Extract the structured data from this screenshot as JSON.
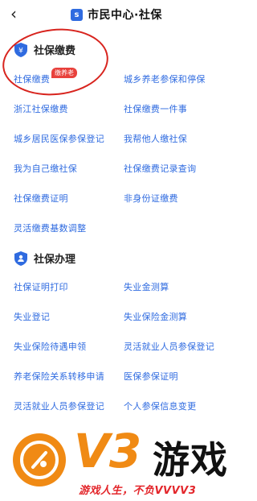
{
  "header": {
    "title": "市民中心·社保",
    "app_icon_glyph": "s",
    "back_icon": "chevron-left-icon"
  },
  "section1": {
    "title": "社保缴费",
    "icon": "shield-yen-icon",
    "badge": "缴养老",
    "items": [
      {
        "label": "社保缴费"
      },
      {
        "label": "城乡养老参保和停保"
      },
      {
        "label": "浙江社保缴费"
      },
      {
        "label": "社保缴费一件事"
      },
      {
        "label": "城乡居民医保参保登记"
      },
      {
        "label": "我帮他人缴社保"
      },
      {
        "label": "我为自己缴社保"
      },
      {
        "label": "社保缴费记录查询"
      },
      {
        "label": "社保缴费证明"
      },
      {
        "label": "非身份证缴费"
      },
      {
        "label": "灵活缴费基数调整"
      }
    ]
  },
  "section2": {
    "title": "社保办理",
    "icon": "shield-person-icon",
    "items": [
      {
        "label": "社保证明打印"
      },
      {
        "label": "失业金测算"
      },
      {
        "label": "失业登记"
      },
      {
        "label": "失业保险金测算"
      },
      {
        "label": "失业保险待遇申领"
      },
      {
        "label": "灵活就业人员参保登记"
      },
      {
        "label": "养老保险关系转移申请"
      },
      {
        "label": "医保参保证明"
      },
      {
        "label": "灵活就业人员参保登记"
      },
      {
        "label": "个人参保信息变更"
      }
    ]
  },
  "watermark": {
    "big": "V3",
    "game": "游戏",
    "slogan": "游戏人生，不负VVVV3"
  },
  "colors": {
    "link": "#2f6be0",
    "annotation_ring": "#d8241e",
    "badge": "#e8413c",
    "watermark_orange": "#f08a14"
  }
}
